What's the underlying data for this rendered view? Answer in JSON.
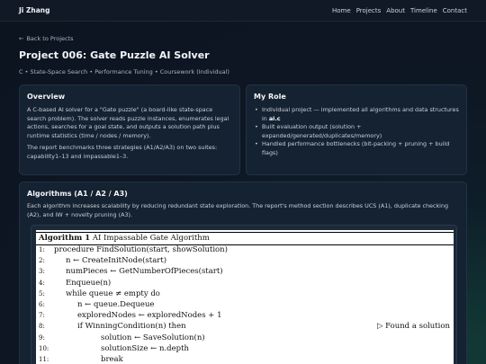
{
  "navbar": {
    "brand": "Ji Zhang",
    "links": [
      "Home",
      "Projects",
      "About",
      "Timeline",
      "Contact"
    ]
  },
  "back_link": {
    "arrow": "←",
    "label": "Back to Projects"
  },
  "page_title": "Project 006: Gate Puzzle AI Solver",
  "subtitle": "C • State-Space Search • Performance Tuning • Coursework (Individual)",
  "overview": {
    "heading": "Overview",
    "p1": "A C-based AI solver for a \"Gate puzzle\" (a board-like state-space search problem). The solver reads puzzle instances, enumerates legal actions, searches for a goal state, and outputs a solution path plus runtime statistics (time / nodes / memory).",
    "p2": "The report benchmarks three strategies (A1/A2/A3) on two suites: capability1–13 and impassable1–3."
  },
  "role": {
    "heading": "My Role",
    "item1_text": "Individual project — implemented all algorithms and data structures in ",
    "item1_file": "ai.c",
    "item2": "Built evaluation output (solution + expanded/generated/duplicates/memory)",
    "item3": "Handled performance bottlenecks (bit-packing + pruning + build flags)"
  },
  "algorithms": {
    "heading": "Algorithms (A1 / A2 / A3)",
    "description": "Each algorithm increases scalability by reducing redundant state exploration. The report's method section describes UCS (A1), duplicate checking (A2), and IW + novelty pruning (A3)."
  },
  "algorithm_image": {
    "header_label": "Algorithm 1",
    "header_title": "AI Impassable Gate Algorithm",
    "lines": [
      {
        "n": "1:",
        "text": "procedure FindSolution(start, showSolution)",
        "indent": 0,
        "comment": ""
      },
      {
        "n": "2:",
        "text": "n ← CreateInitNode(start)",
        "indent": 1,
        "comment": ""
      },
      {
        "n": "3:",
        "text": "numPieces ← GetNumberOfPieces(start)",
        "indent": 1,
        "comment": ""
      },
      {
        "n": "4:",
        "text": "Enqueue(n)",
        "indent": 1,
        "comment": ""
      },
      {
        "n": "5:",
        "text": "while queue ≠ empty do",
        "indent": 1,
        "comment": ""
      },
      {
        "n": "6:",
        "text": "n ← queue.Dequeue",
        "indent": 2,
        "comment": ""
      },
      {
        "n": "7:",
        "text": "exploredNodes ← exploredNodes + 1",
        "indent": 2,
        "comment": ""
      },
      {
        "n": "8:",
        "text": "if WinningCondition(n) then",
        "indent": 2,
        "comment": "▷ Found a solution"
      },
      {
        "n": "9:",
        "text": "solution ← SaveSolution(n)",
        "indent": 3,
        "comment": ""
      },
      {
        "n": "10:",
        "text": "solutionSize ← n.depth",
        "indent": 3,
        "comment": ""
      },
      {
        "n": "11:",
        "text": "break",
        "indent": 3,
        "comment": ""
      }
    ]
  }
}
